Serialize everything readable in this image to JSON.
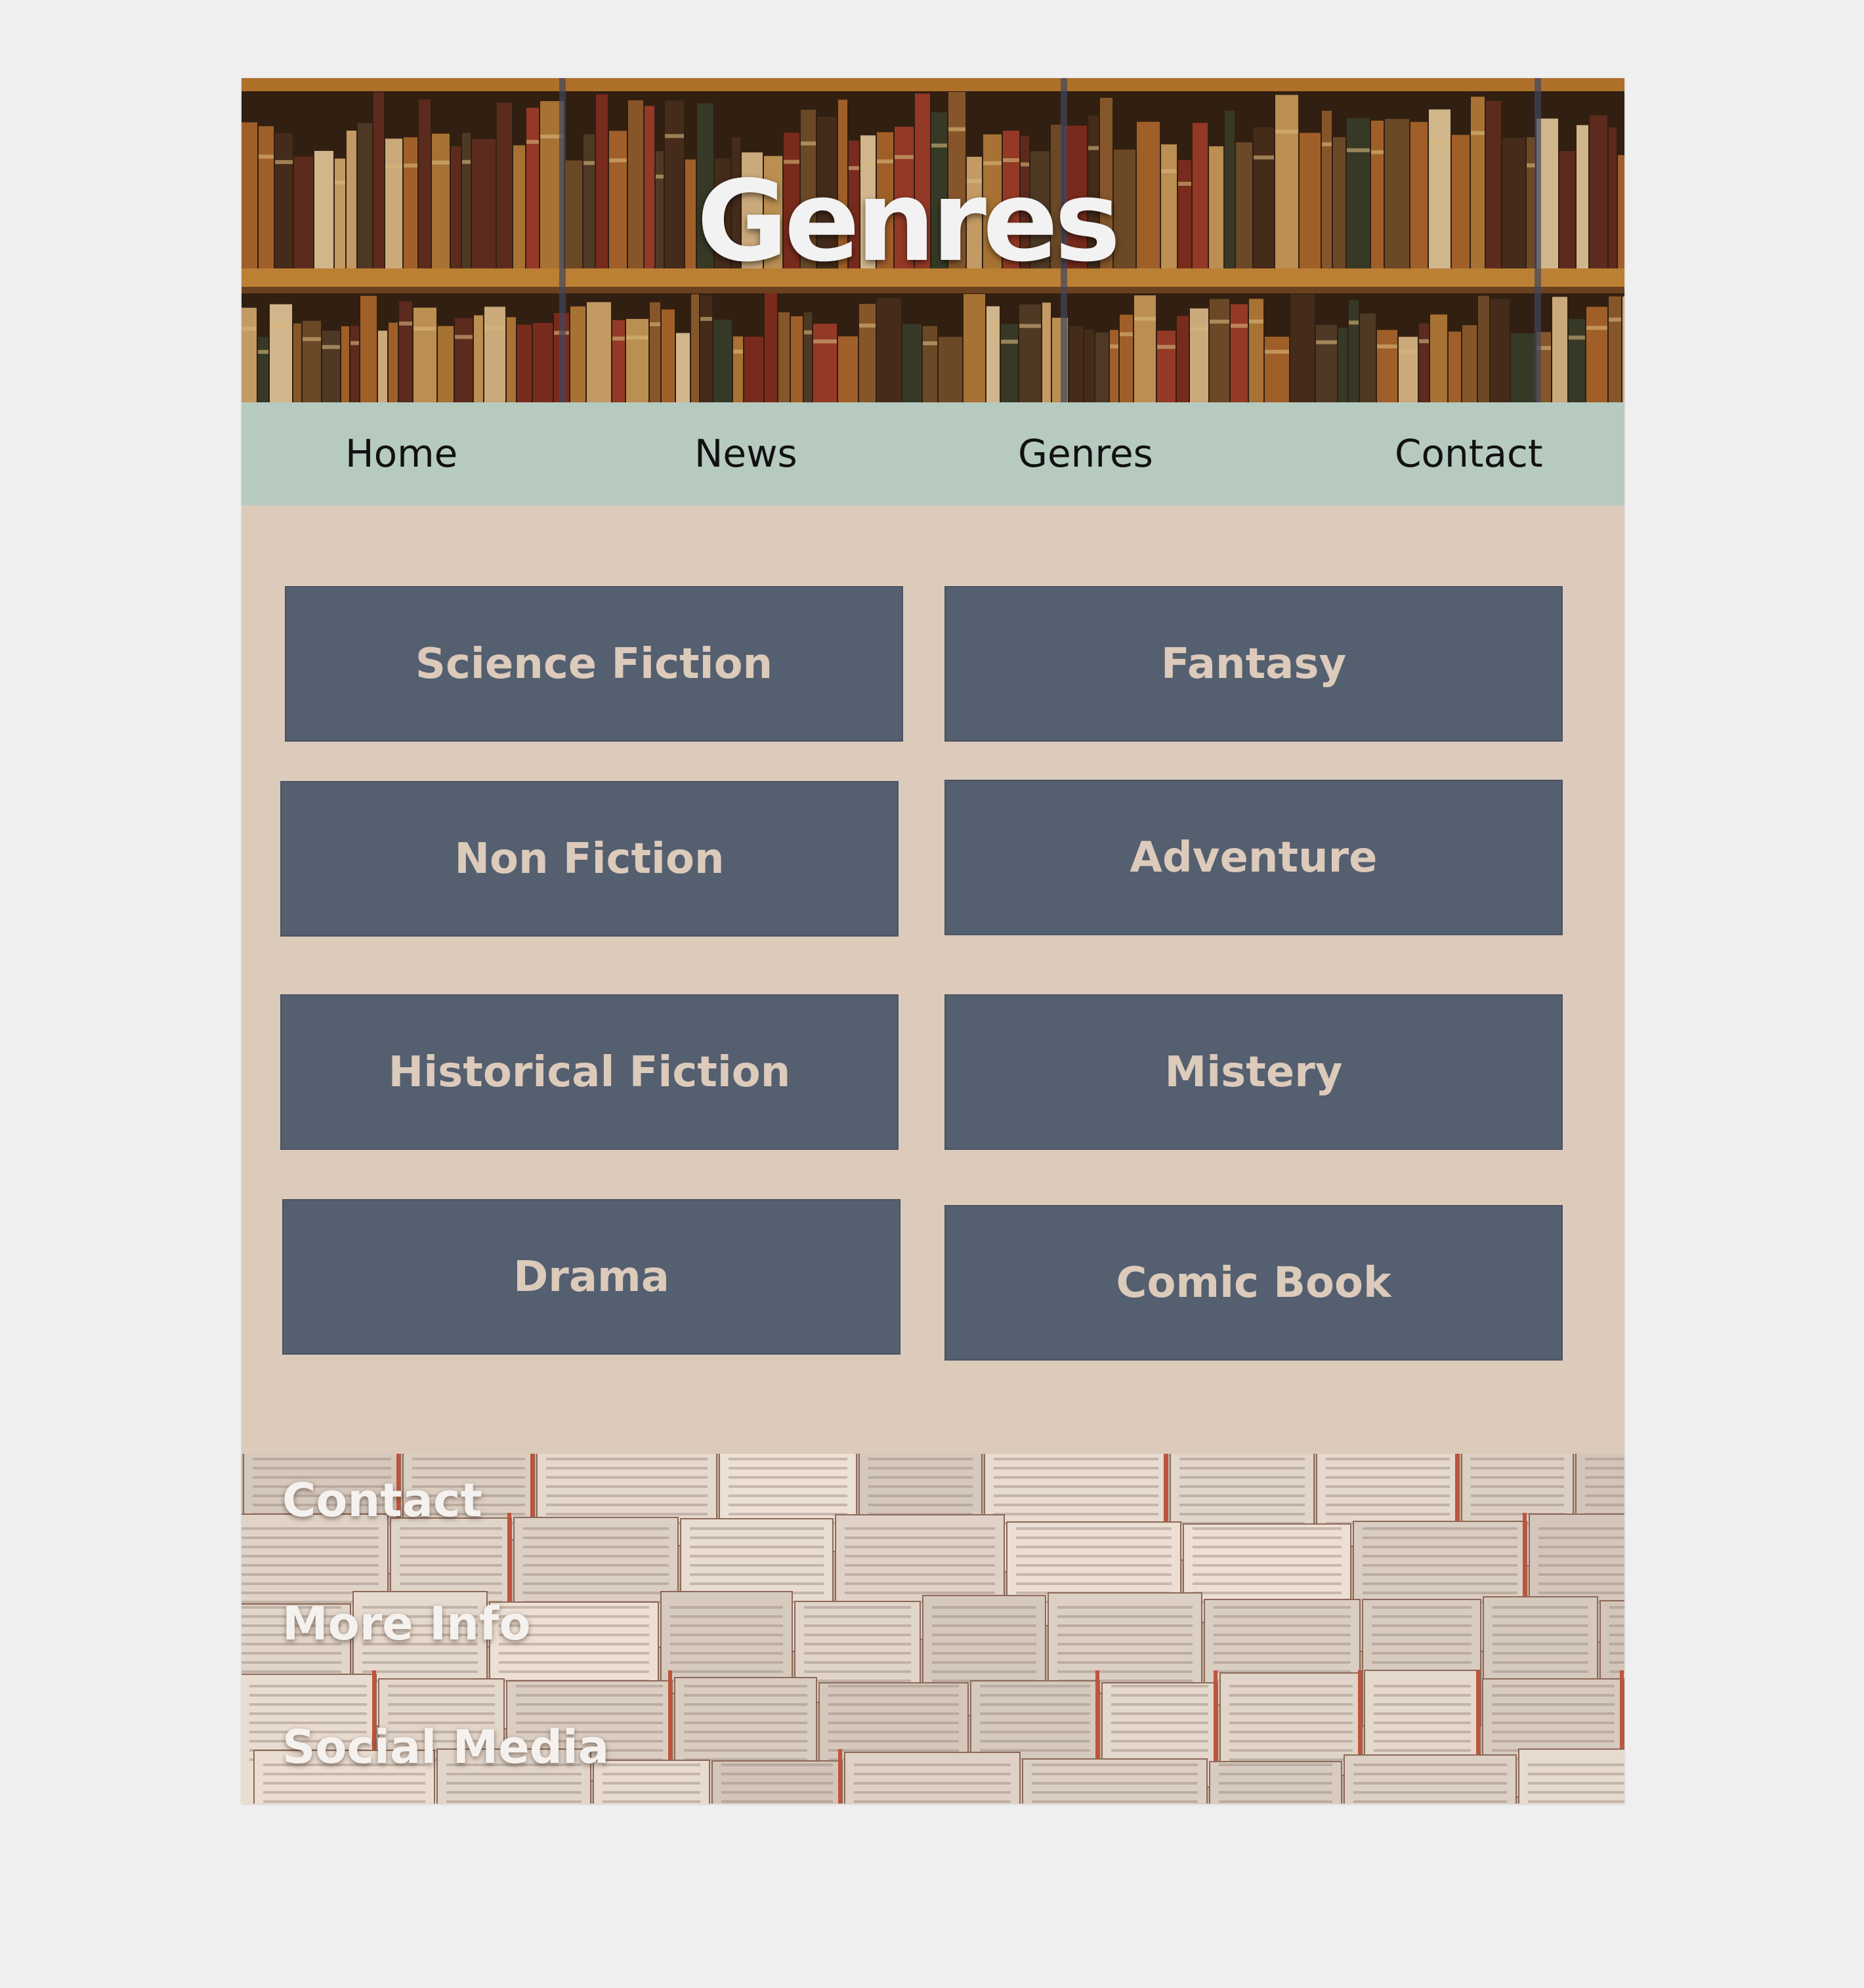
{
  "header": {
    "title": "Genres",
    "background": "bookshelf-photo"
  },
  "nav": {
    "items": [
      "Home",
      "News",
      "Genres",
      "Contact"
    ]
  },
  "genres": {
    "items": [
      "Science Fiction",
      "Fantasy",
      "Non Fiction",
      "Adventure",
      "Historical Fiction",
      "Mistery",
      "Drama",
      "Comic Book"
    ]
  },
  "footer": {
    "background": "open-books-photo",
    "links": [
      "Contact",
      "More Info",
      "Social Media"
    ]
  },
  "colors": {
    "page_background": "#efefef",
    "content_background": "#dccabb",
    "nav_background": "#b6cac0",
    "tile_background": "#545f6f",
    "tile_text": "#dccabb"
  }
}
